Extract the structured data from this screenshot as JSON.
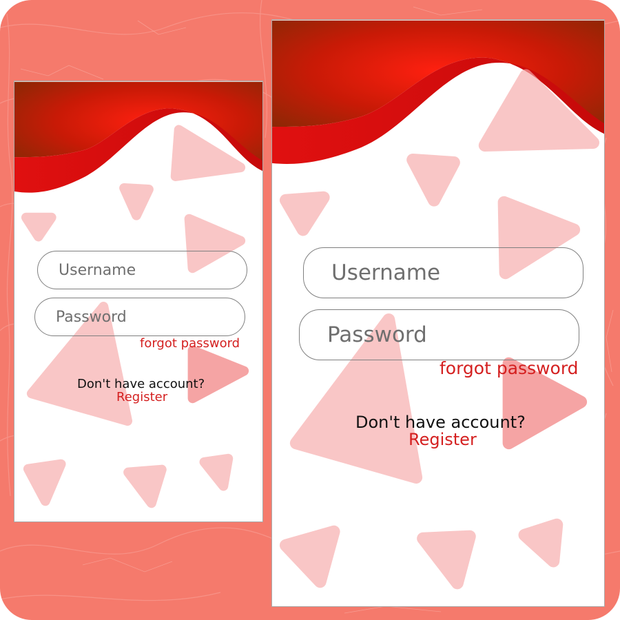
{
  "screens": [
    {
      "id": "small",
      "username_placeholder": "Username",
      "password_placeholder": "Password",
      "forgot_label": "forgot password",
      "no_account_text": "Don't have account?",
      "register_label": "Register"
    },
    {
      "id": "large",
      "username_placeholder": "Username",
      "password_placeholder": "Password",
      "forgot_label": "forgot password",
      "no_account_text": "Don't have account?",
      "register_label": "Register"
    }
  ],
  "colors": {
    "background": "#f57a6c",
    "wave_dark": "#8b1a05",
    "wave_bright": "#e01010",
    "shape": "#f7a9a9",
    "link": "#d42020"
  },
  "icons": [
    "triangle-shape",
    "wave-header"
  ]
}
